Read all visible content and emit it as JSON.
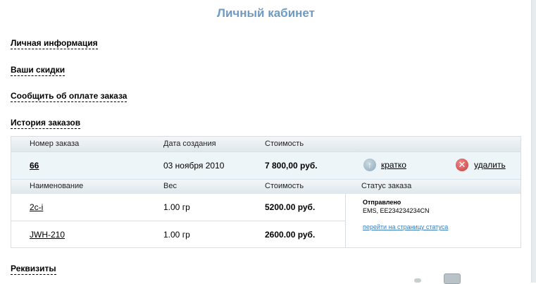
{
  "page_title": "Личный кабинет",
  "sections": {
    "personal": "Личная информация",
    "discounts": "Ваши скидки",
    "payment": "Сообщить об оплате заказа",
    "history": "История заказов",
    "requisites": "Реквизиты"
  },
  "order_header": {
    "number": "Номер заказа",
    "date": "Дата создания",
    "cost": "Стоимость"
  },
  "order": {
    "number": "66",
    "date": "03 ноября 2010",
    "cost": "7 800,00 руб.",
    "collapse_label": "кратко",
    "delete_label": "удалить"
  },
  "items_header": {
    "name": "Наименование",
    "weight": "Вес",
    "cost": "Стоимость",
    "status": "Статус заказа"
  },
  "items": [
    {
      "name": "2c-i",
      "weight": "1.00 гр",
      "cost": "5200.00 руб."
    },
    {
      "name": "JWH-210",
      "weight": "1.00 гр",
      "cost": "2600.00 руб."
    }
  ],
  "status": {
    "state": "Отправлено",
    "tracking": "EMS, EE234234234CN",
    "link": "перейти на страницу статуса"
  },
  "colors": {
    "title": "#6d9bc3",
    "link_blue": "#3a7fbf",
    "delete_red": "#c93d3d"
  }
}
